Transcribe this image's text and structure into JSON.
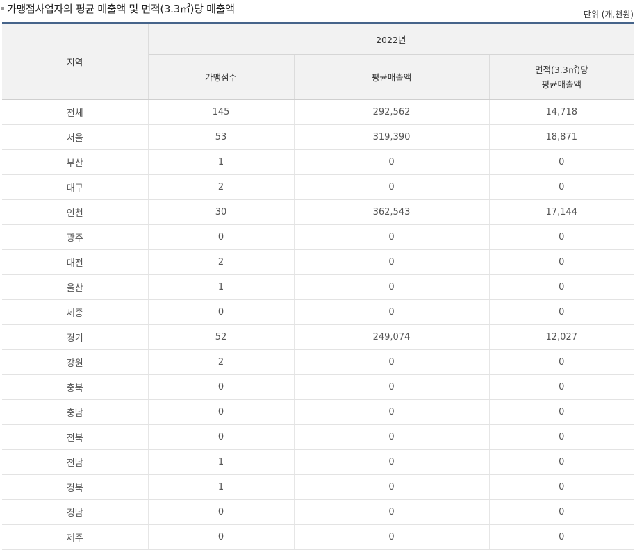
{
  "header": {
    "title": "가맹점사업자의 평균 매출액 및 면적(3.3㎡)당 매출액",
    "unit": "단위 (개,천원)"
  },
  "table": {
    "region_header": "지역",
    "year_header": "2022년",
    "columns": [
      "가맹점수",
      "평균매출액",
      "면적(3.3㎡)당",
      "평균매출액"
    ],
    "rows": [
      [
        "전체",
        "145",
        "292,562",
        "14,718"
      ],
      [
        "서울",
        "53",
        "319,390",
        "18,871"
      ],
      [
        "부산",
        "1",
        "0",
        "0"
      ],
      [
        "대구",
        "2",
        "0",
        "0"
      ],
      [
        "인천",
        "30",
        "362,543",
        "17,144"
      ],
      [
        "광주",
        "0",
        "0",
        "0"
      ],
      [
        "대전",
        "2",
        "0",
        "0"
      ],
      [
        "울산",
        "1",
        "0",
        "0"
      ],
      [
        "세종",
        "0",
        "0",
        "0"
      ],
      [
        "경기",
        "52",
        "249,074",
        "12,027"
      ],
      [
        "강원",
        "2",
        "0",
        "0"
      ],
      [
        "충북",
        "0",
        "0",
        "0"
      ],
      [
        "충남",
        "0",
        "0",
        "0"
      ],
      [
        "전북",
        "0",
        "0",
        "0"
      ],
      [
        "전남",
        "1",
        "0",
        "0"
      ],
      [
        "경북",
        "1",
        "0",
        "0"
      ],
      [
        "경남",
        "0",
        "0",
        "0"
      ],
      [
        "제주",
        "0",
        "0",
        "0"
      ]
    ]
  },
  "colors": {
    "header_bg": "#f2f2f2",
    "top_border": "#46648a"
  }
}
